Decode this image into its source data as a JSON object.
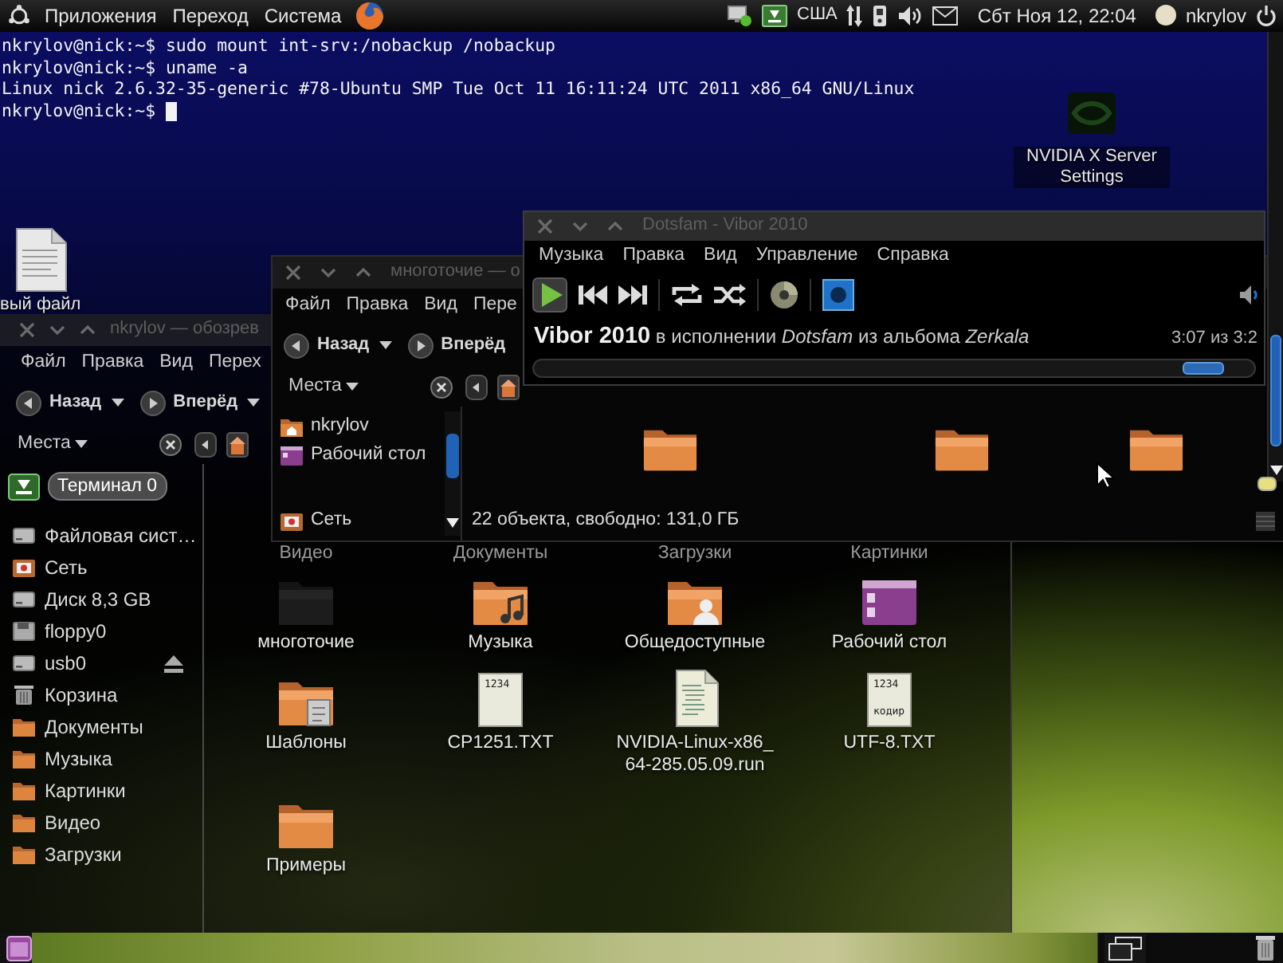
{
  "top_panel": {
    "menus": [
      "Приложения",
      "Переход",
      "Система"
    ],
    "keyboard_layout": "США",
    "clock": "Сбт Ноя 12, 22:04",
    "user": "nkrylov"
  },
  "terminal": {
    "lines": [
      "nkrylov@nick:~$ sudo mount int-srv:/nobackup /nobackup",
      "nkrylov@nick:~$ uname -a",
      "Linux nick 2.6.32-35-generic #78-Ubuntu SMP Tue Oct 11 16:11:24 UTC 2011 x86_64 GNU/Linux",
      "nkrylov@nick:~$"
    ]
  },
  "desktop_icons": [
    {
      "kind": "app",
      "label": "NVIDIA X Server Settings"
    },
    {
      "kind": "document",
      "label": "вый файл"
    }
  ],
  "player_window": {
    "title": "Dotsfam - Vibor 2010",
    "menus": [
      "Музыка",
      "Правка",
      "Вид",
      "Управление",
      "Справка"
    ],
    "now_playing": "**Vibor 2010** в исполнении *Dotsfam* из альбома *Zerkala*",
    "time": "3:07 из 3:2",
    "seek": {
      "level": 0.93
    }
  },
  "folder_window": {
    "title": "многоточие — о",
    "menus": [
      "Файл",
      "Правка",
      "Вид",
      "Пере"
    ],
    "back": "Назад",
    "forward": "Вперёд",
    "places": "Места",
    "sidebar": [
      {
        "kind": "home",
        "label": "nkrylov"
      },
      {
        "kind": "desktop",
        "label": "Рабочий стол"
      },
      {
        "kind": "network",
        "label": "Сеть"
      }
    ],
    "items": [
      {
        "kind": "folder"
      },
      {
        "kind": "folder"
      },
      {
        "kind": "folder"
      }
    ],
    "status": "22 объекта, свободно: 131,0 ГБ"
  },
  "home_window": {
    "title": "nkrylov — обозрев",
    "menus": [
      "Файл",
      "Правка",
      "Вид",
      "Перех"
    ],
    "back": "Назад",
    "forward": "Вперёд",
    "places": "Места",
    "sidebar": [
      {
        "kind": "filesystem",
        "label": "Файловая сист…"
      },
      {
        "kind": "network",
        "label": "Сеть"
      },
      {
        "kind": "disk",
        "label": "Диск 8,3 GB"
      },
      {
        "kind": "floppy",
        "label": "floppy0"
      },
      {
        "kind": "usb",
        "label": "usb0"
      },
      {
        "kind": "trash",
        "label": "Корзина"
      },
      {
        "kind": "folder",
        "label": "Документы"
      },
      {
        "kind": "folder",
        "label": "Музыка"
      },
      {
        "kind": "folder",
        "label": "Картинки"
      },
      {
        "kind": "folder",
        "label": "Видео"
      },
      {
        "kind": "folder",
        "label": "Загрузки"
      }
    ],
    "partial_labels": [
      "Видео",
      "Документы",
      "Загрузки",
      "Картинки"
    ],
    "items": [
      {
        "kind": "dim_folder",
        "label": "многоточие"
      },
      {
        "kind": "music_folder",
        "label": "Музыка"
      },
      {
        "kind": "public_folder",
        "label": "Общедоступные"
      },
      {
        "kind": "desktop_folder",
        "label": "Рабочий стол"
      },
      {
        "kind": "templates_folder",
        "label": "Шаблоны"
      },
      {
        "kind": "text_file",
        "label": "CP1251.TXT",
        "preview": [
          "1234"
        ]
      },
      {
        "kind": "script_file",
        "label": "NVIDIA-Linux-x86_64-285.05.09.run"
      },
      {
        "kind": "text_file",
        "label": "UTF-8.TXT",
        "preview": [
          "1234",
          "кодир"
        ]
      },
      {
        "kind": "folder",
        "label": "Примеры"
      }
    ]
  },
  "window_button": {
    "label": "Терминал 0"
  }
}
